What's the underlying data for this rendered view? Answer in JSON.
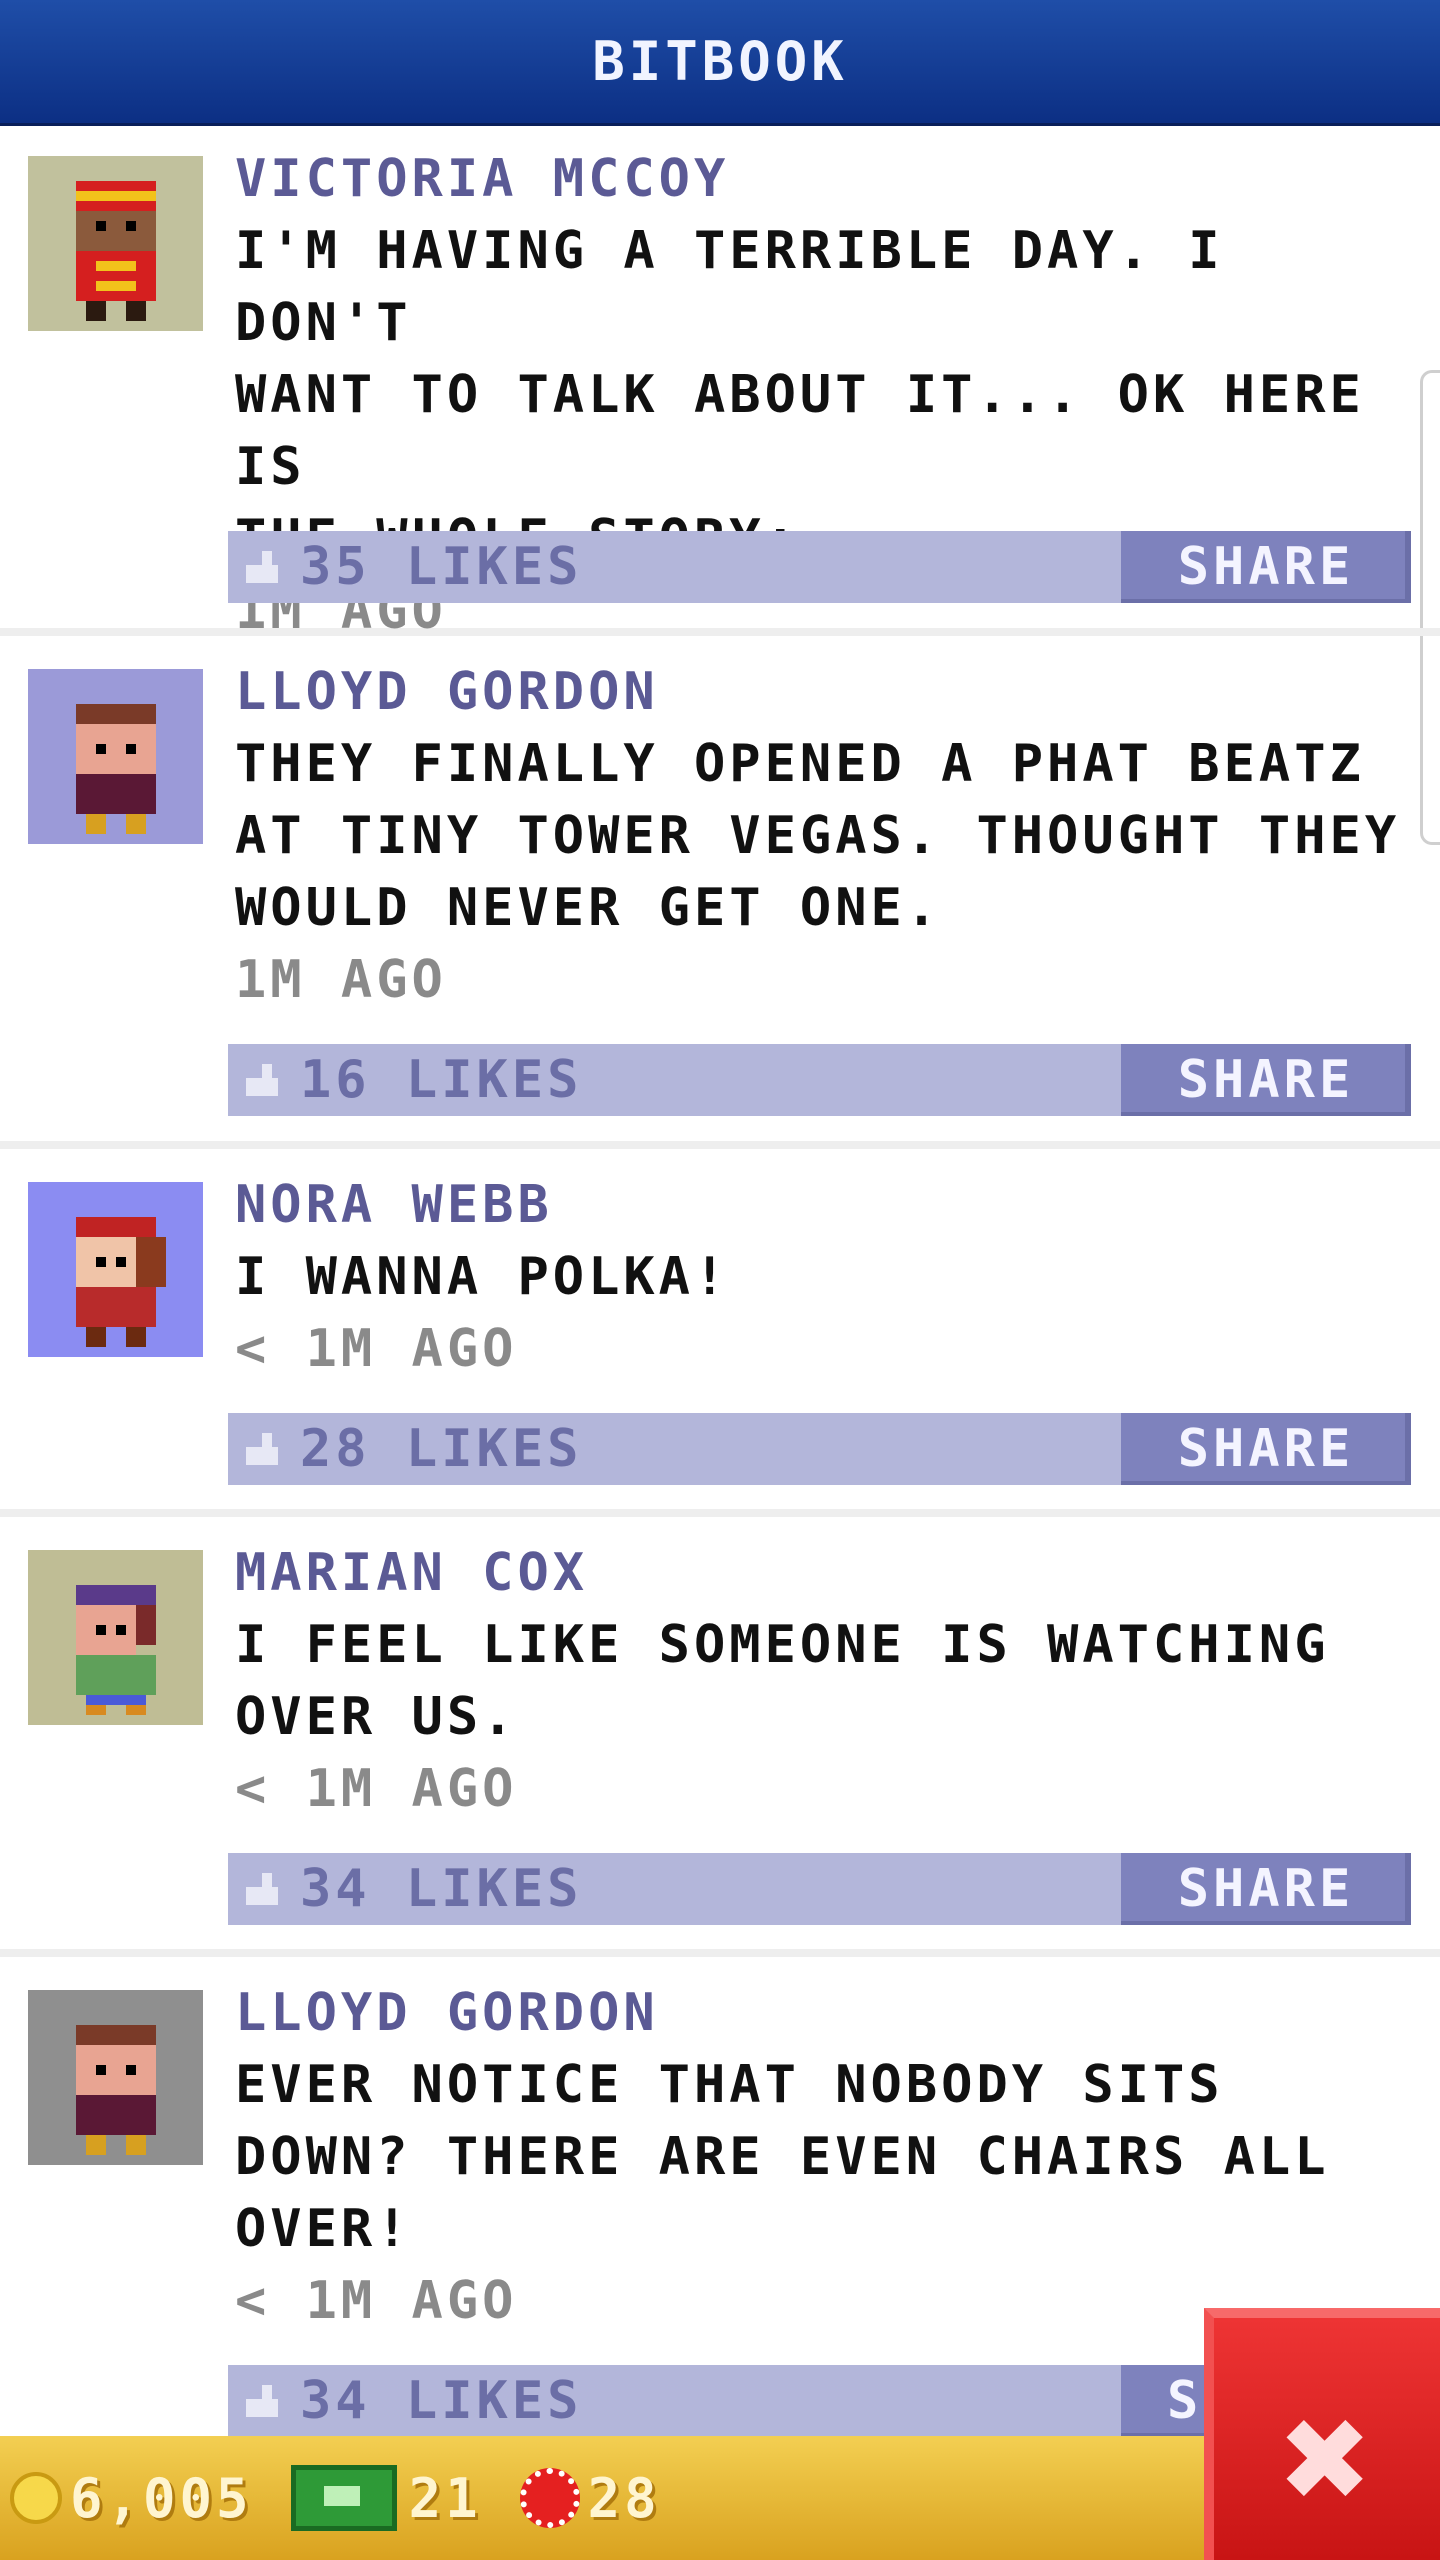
{
  "header": {
    "title": "BITBOOK"
  },
  "posts": [
    {
      "name": "VICTORIA MCCOY",
      "lines": [
        "I'M HAVING A TERRIBLE DAY. I DON'T",
        "WANT TO TALK ABOUT IT...  OK HERE IS",
        "THE WHOLE STORY:"
      ],
      "time": "1M AGO",
      "likes": "35 LIKES",
      "share": "SHARE",
      "avatar_bg": "#c1c19d"
    },
    {
      "name": "LLOYD GORDON",
      "lines": [
        "THEY FINALLY OPENED A PHAT BEATZ",
        "AT TINY TOWER VEGAS. THOUGHT THEY",
        "WOULD NEVER GET ONE."
      ],
      "time": "1M AGO",
      "likes": "16 LIKES",
      "share": "SHARE",
      "avatar_bg": "#9b9ad8"
    },
    {
      "name": "NORA WEBB",
      "lines": [
        "I WANNA POLKA!"
      ],
      "time": "< 1M AGO",
      "likes": "28 LIKES",
      "share": "SHARE",
      "avatar_bg": "#8b8cf2"
    },
    {
      "name": "MARIAN COX",
      "lines": [
        "I FEEL LIKE SOMEONE IS WATCHING",
        "OVER US."
      ],
      "time": "< 1M AGO",
      "likes": "34 LIKES",
      "share": "SHARE",
      "avatar_bg": "#bfbd95"
    },
    {
      "name": "LLOYD GORDON",
      "lines": [
        "EVER NOTICE THAT NOBODY SITS",
        "DOWN? THERE ARE EVEN CHAIRS ALL",
        "OVER!"
      ],
      "time": "< 1M AGO",
      "likes": "34 LIKES",
      "share": "S",
      "avatar_bg": "#8f8f8f"
    }
  ],
  "status": {
    "coins": "6,005",
    "bux": "21",
    "chips": "28"
  },
  "colors": {
    "header": "#1f4ea8",
    "name": "#5b5a95",
    "action_bar": "#b3b6da",
    "share": "#7e82bd",
    "close": "#e02626"
  }
}
